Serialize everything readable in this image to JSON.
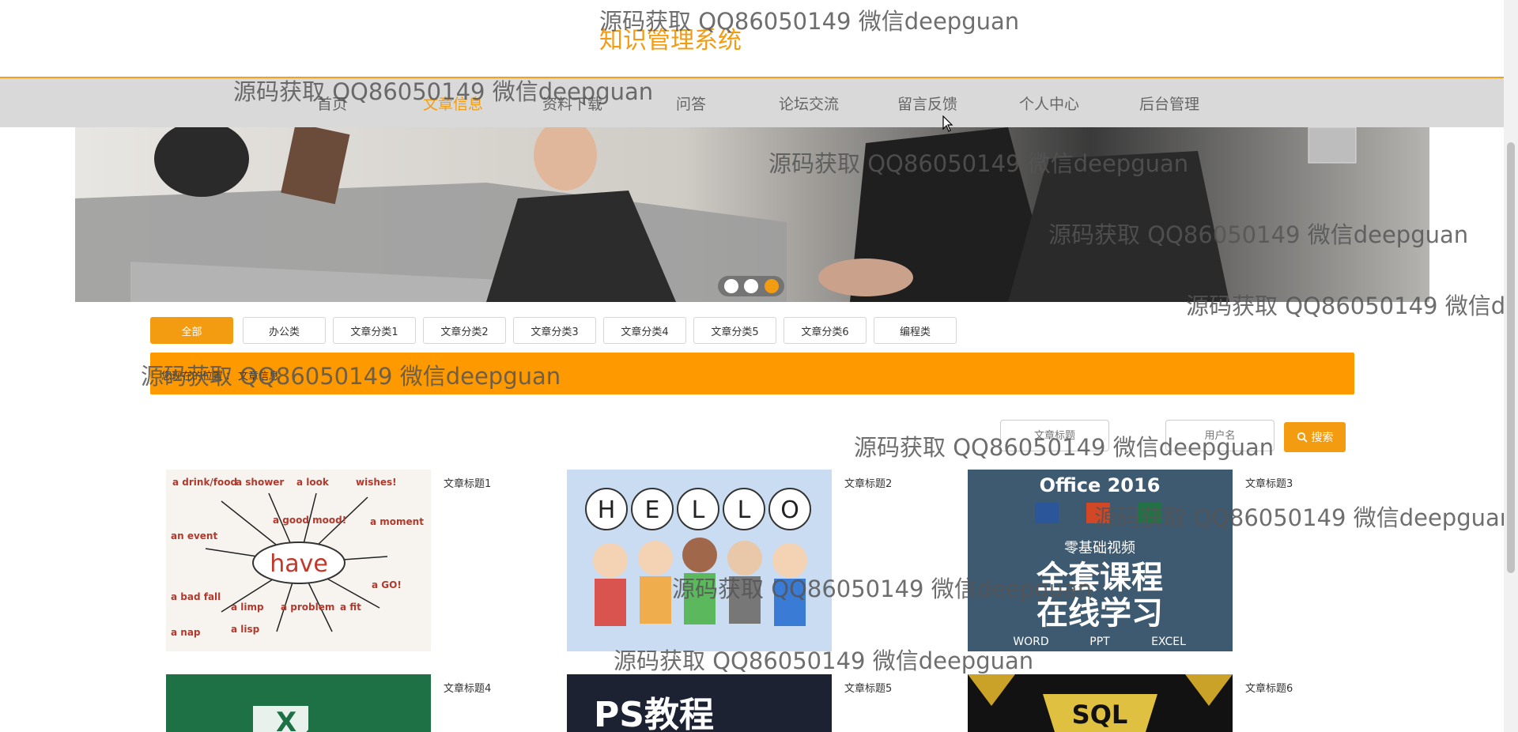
{
  "header": {
    "title": "知识管理系统"
  },
  "nav": {
    "items": [
      {
        "label": "首页"
      },
      {
        "label": "文章信息"
      },
      {
        "label": "资料下载"
      },
      {
        "label": "问答"
      },
      {
        "label": "论坛交流"
      },
      {
        "label": "留言反馈"
      },
      {
        "label": "个人中心"
      },
      {
        "label": "后台管理"
      }
    ],
    "active_index": 1
  },
  "banner": {
    "slide_count": 3,
    "active_slide": 3
  },
  "categories": {
    "items": [
      {
        "label": "全部"
      },
      {
        "label": "办公类"
      },
      {
        "label": "文章分类1"
      },
      {
        "label": "文章分类2"
      },
      {
        "label": "文章分类3"
      },
      {
        "label": "文章分类4"
      },
      {
        "label": "文章分类5"
      },
      {
        "label": "文章分类6"
      },
      {
        "label": "编程类"
      }
    ],
    "active_index": 0
  },
  "breadcrumb": {
    "items": [
      "您现在的位置",
      "文章信息"
    ],
    "separator": "："
  },
  "search": {
    "title_placeholder": "文章标题",
    "username_placeholder": "用户名",
    "button_label": "搜索"
  },
  "articles": [
    {
      "title": "文章标题1",
      "image": "have-mindmap"
    },
    {
      "title": "文章标题2",
      "image": "hello-cartoon"
    },
    {
      "title": "文章标题3",
      "image": "office-2016-course"
    },
    {
      "title": "文章标题4",
      "image": "excel-green"
    },
    {
      "title": "文章标题5",
      "image": "ps-tutorial"
    },
    {
      "title": "文章标题6",
      "image": "sql-gold"
    }
  ],
  "article_images": {
    "have": {
      "word": "have",
      "sub_labels": [
        "a drink/food",
        "a shower",
        "a look",
        "wishes!",
        "a good mood!",
        "an event",
        "a moment",
        "a bad fall",
        "a limp",
        "a problem",
        "a fit",
        "a GO!",
        "a nap",
        "a lisp"
      ]
    },
    "hello": {
      "letters": [
        "H",
        "E",
        "L",
        "L",
        "O"
      ]
    },
    "office": {
      "title": "Office 2016",
      "line1": "零基础视频",
      "line2": "全套课程",
      "line3": "在线学习",
      "footer": [
        "WORD",
        "PPT",
        "EXCEL"
      ]
    },
    "excel": {
      "text": "X 月"
    },
    "ps": {
      "text": "PS教程"
    },
    "sql": {
      "text": "SQL"
    }
  },
  "watermark": {
    "text": "源码获取 QQ86050149 微信deepguan"
  },
  "colors": {
    "accent": "#f39c12",
    "crumb_bar": "#ff9900",
    "nav_bg": "#d9d9d9"
  }
}
